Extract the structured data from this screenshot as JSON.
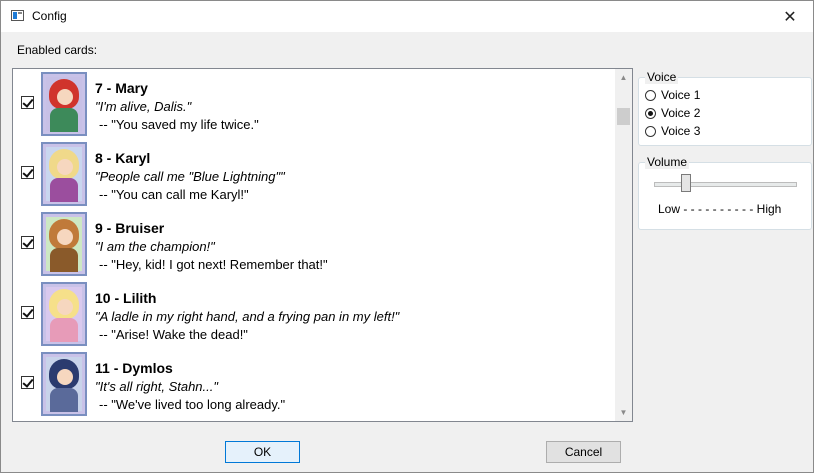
{
  "window": {
    "title": "Config",
    "close_glyph": "✕"
  },
  "cards_label": "Enabled cards:",
  "cards": [
    {
      "title": "7 - Mary",
      "quote": "\"I'm alive, Dalis.\"",
      "reply": "-- \"You saved my life twice.\"",
      "enabled": true
    },
    {
      "title": "8 - Karyl",
      "quote": "\"People call me \"Blue Lightning\"\"",
      "reply": "-- \"You can call me Karyl!\"",
      "enabled": true
    },
    {
      "title": "9 - Bruiser",
      "quote": "\"I am the champion!\"",
      "reply": "-- \"Hey, kid! I got next! Remember that!\"",
      "enabled": true
    },
    {
      "title": "10 - Lilith",
      "quote": "\"A ladle in my right hand, and a frying pan in my left!\"",
      "reply": "-- \"Arise! Wake the dead!\"",
      "enabled": true
    },
    {
      "title": "11 - Dymlos",
      "quote": "\"It's all right, Stahn...\"",
      "reply": "-- \"We've lived too long already.\"",
      "enabled": true
    }
  ],
  "portrait_colors": [
    {
      "bg": "#c7c0e6",
      "hair": "#d0342c",
      "body": "#3d8a5a"
    },
    {
      "bg": "#c9d6ef",
      "hair": "#f0d98a",
      "body": "#9b4e9e"
    },
    {
      "bg": "#cde8c3",
      "hair": "#c07a3a",
      "body": "#8a5a2a"
    },
    {
      "bg": "#d9c9ee",
      "hair": "#f6e08a",
      "body": "#e79bb8"
    },
    {
      "bg": "#c8d3ea",
      "hair": "#2b3b6f",
      "body": "#5a6a9a"
    }
  ],
  "voice": {
    "label": "Voice",
    "options": [
      {
        "label": "Voice 1",
        "selected": false
      },
      {
        "label": "Voice 2",
        "selected": true
      },
      {
        "label": "Voice 3",
        "selected": false
      }
    ]
  },
  "volume": {
    "label": "Volume",
    "range_label": "Low - - - - - - - - - - High",
    "level": 0.2
  },
  "buttons": {
    "ok": "OK",
    "cancel": "Cancel"
  },
  "scrollbar": {
    "up_glyph": "▲",
    "down_glyph": "▼"
  }
}
